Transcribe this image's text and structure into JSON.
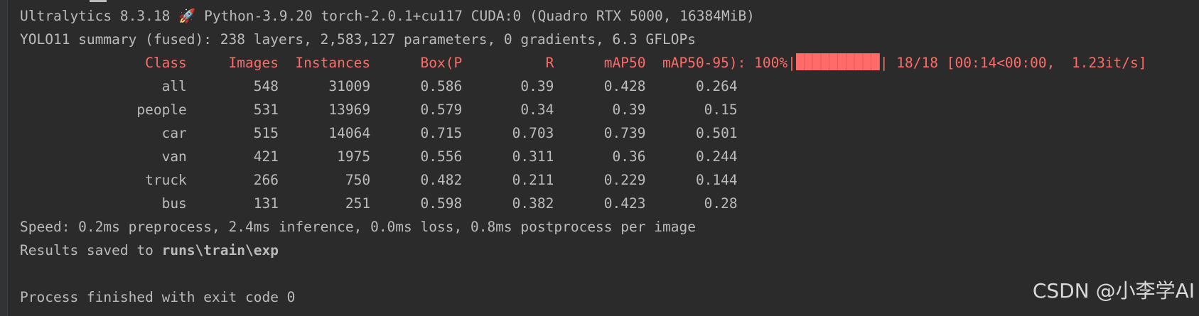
{
  "terminal": {
    "header_line": "Ultralytics 8.3.18 🚀 Python-3.9.20 torch-2.0.1+cu117 CUDA:0 (Quadro RTX 5000, 16384MiB)",
    "summary_line": "YOLO11 summary (fused): 238 layers, 2,583,127 parameters, 0 gradients, 6.3 GFLOPs",
    "table_header": "               Class     Images  Instances      Box(P          R      mAP50  mAP50-95): 100%|",
    "progress": {
      "fraction": 1.0,
      "after": "| 18/18 [00:14<00:00,  1.23it/s]"
    },
    "rows": [
      "                 all        548      31009      0.586       0.39      0.428      0.264",
      "              people        531      13969      0.579       0.34       0.39       0.15",
      "                 car        515      14064      0.715      0.703      0.739      0.501",
      "                 van        421       1975      0.556      0.311       0.36      0.244",
      "               truck        266        750      0.482      0.211      0.229      0.144",
      "                 bus        131        251      0.598      0.382      0.423       0.28"
    ],
    "speed_line": "Speed: 0.2ms preprocess, 2.4ms inference, 0.0ms loss, 0.8ms postprocess per image",
    "results_prefix": "Results saved to ",
    "results_path": "runs\\train\\exp",
    "process_line": "Process finished with exit code 0"
  },
  "watermark": "CSDN @小李学AI",
  "colors": {
    "background": "#2b2b2b",
    "text": "#bbbbbb",
    "stderr_red": "#ff6b68"
  }
}
